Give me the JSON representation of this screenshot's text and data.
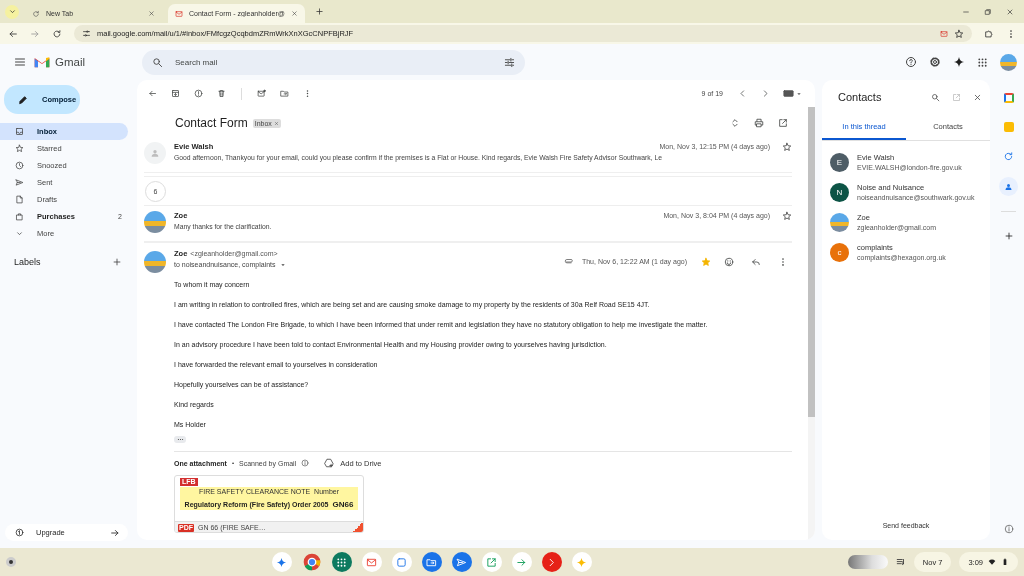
{
  "browser": {
    "tabs": [
      {
        "title": "New Tab",
        "selected": false
      },
      {
        "title": "Contact Form - zgleanholder@",
        "selected": true
      }
    ],
    "url": "mail.google.com/mail/u/1/#inbox/FMfcgzQcqbdmZRmWrkXnXGcCNPFBjRJF"
  },
  "header": {
    "product": "Gmail",
    "search": {
      "placeholder": "Search mail"
    }
  },
  "sidebar": {
    "compose": "Compose",
    "items": [
      {
        "label": "Inbox",
        "selected": true,
        "unread": false
      },
      {
        "label": "Starred",
        "selected": false,
        "unread": false
      },
      {
        "label": "Snoozed",
        "selected": false,
        "unread": false
      },
      {
        "label": "Sent",
        "selected": false,
        "unread": false
      },
      {
        "label": "Drafts",
        "selected": false,
        "unread": false
      },
      {
        "label": "Purchases",
        "selected": false,
        "unread": true,
        "count": "2"
      },
      {
        "label": "More",
        "selected": false,
        "unread": false
      }
    ],
    "labels_heading": "Labels",
    "upgrade": "Upgrade"
  },
  "toolbar": {
    "position": "9 of 19"
  },
  "thread": {
    "subject": "Contact Form",
    "label": "Inbox",
    "collapsed": [
      {
        "kind": "silhouette",
        "sender": "Evie Walsh",
        "snippet": "Good afternoon, Thankyou for your email, could you please confirm if the premises is a Flat or House. Kind regards, Evie Walsh Fire Safety Advisor Southwark, Le",
        "date": "Mon, Nov 3, 12:15 PM (4 days ago)",
        "starred": false
      },
      {
        "kind": "hidden_count",
        "count": "6"
      },
      {
        "kind": "photo",
        "sender": "Zoe",
        "snippet": "Many thanks for the clarification.",
        "date": "Mon, Nov 3, 8:04 PM (4 days ago)",
        "starred": false
      }
    ],
    "message": {
      "sender": "Zoe",
      "email": "<zgleanholder@gmail.com>",
      "to": "to noiseandnuisance, complaints",
      "date": "Thu, Nov 6, 12:22 AM (1 day ago)",
      "starred": true,
      "body": [
        "To whom it may concern",
        "I am writing in relation to controlled fires, which are being set and are causing smoke damage to my property by the residents of 30a Relf Road SE15 4JT.",
        "I have contacted The London Fire Brigade, to which I have been informed that under remit and legislation they have no statutory obligation to help me investigate the matter.",
        "In an advisory procedure I have been told to contact Environmental Health and my Housing provider owing to yourselves having jurisdiction.",
        "I have forwarded the relevant email to yourselves in consideration",
        "Hopefully yourselves can be of assistance?",
        "Kind regards",
        "Ms Holder"
      ],
      "attachments_heading": "One attachment",
      "separator": "•",
      "scanned": "Scanned by Gmail",
      "add_to_drive": "Add to Drive",
      "attachment": {
        "name": "GN 66 (FIRE SAFE…",
        "file_type": "PDF",
        "preview": {
          "logo": "LFB",
          "title": "FIRE SAFETY CLEARANCE NOTE",
          "number_label": "Number",
          "subtitle": "Regulatory Reform (Fire Safety) Order 2005",
          "number": "GN66"
        }
      }
    }
  },
  "contacts": {
    "title": "Contacts",
    "tabs": [
      {
        "label": "In this thread",
        "selected": true
      },
      {
        "label": "Contacts",
        "selected": false
      }
    ],
    "people": [
      {
        "kind": "letter",
        "initial": "E",
        "color": "#4e5d66",
        "name": "Evie Walsh",
        "email": "EVIE.WALSH@london-fire.gov.uk"
      },
      {
        "kind": "letter",
        "initial": "N",
        "color": "#0d5446",
        "name": "Noise and Nuisance",
        "email": "noiseandnuisance@southwark.gov.uk"
      },
      {
        "kind": "photo",
        "name": "Zoe",
        "email": "zgleanholder@gmail.com"
      },
      {
        "kind": "letter",
        "initial": "c",
        "color": "#e8710a",
        "name": "complaints",
        "email": "complaints@hexagon.org.uk"
      }
    ],
    "feedback": "Send feedback"
  },
  "shelf": {
    "date": "Nov 7",
    "time": "3:09"
  }
}
